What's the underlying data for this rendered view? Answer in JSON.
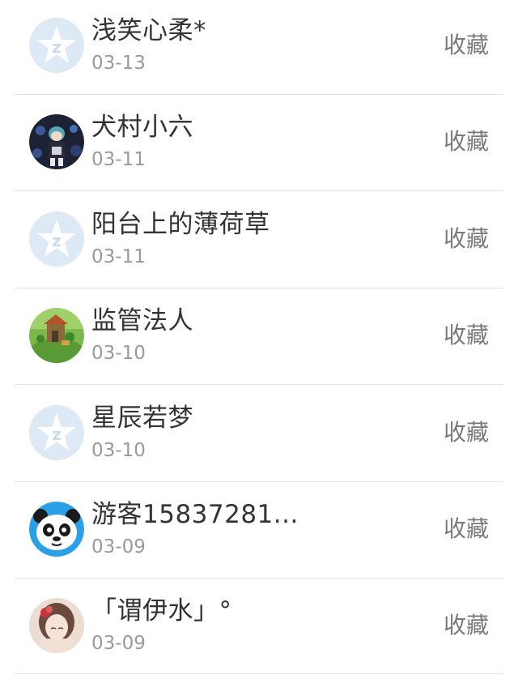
{
  "items": [
    {
      "name": "浅笑心柔*",
      "date": "03-13",
      "action": "收藏",
      "avatar": "qq-default-avatar"
    },
    {
      "name": "犬村小六",
      "date": "03-11",
      "action": "收藏",
      "avatar": "anime-dark-avatar"
    },
    {
      "name": "阳台上的薄荷草",
      "date": "03-11",
      "action": "收藏",
      "avatar": "qq-default-avatar"
    },
    {
      "name": "监管法人",
      "date": "03-10",
      "action": "收藏",
      "avatar": "game-scene-avatar"
    },
    {
      "name": "星辰若梦",
      "date": "03-10",
      "action": "收藏",
      "avatar": "qq-default-avatar"
    },
    {
      "name": "游客15837281...",
      "date": "03-09",
      "action": "收藏",
      "avatar": "panda-avatar"
    },
    {
      "name": "「谓伊水」°",
      "date": "03-09",
      "action": "收藏",
      "avatar": "anime-girl-avatar"
    }
  ],
  "colors": {
    "name": "#333333",
    "date": "#9a9a9a",
    "action": "#7a7a7a",
    "divider": "#e3e3e3"
  }
}
